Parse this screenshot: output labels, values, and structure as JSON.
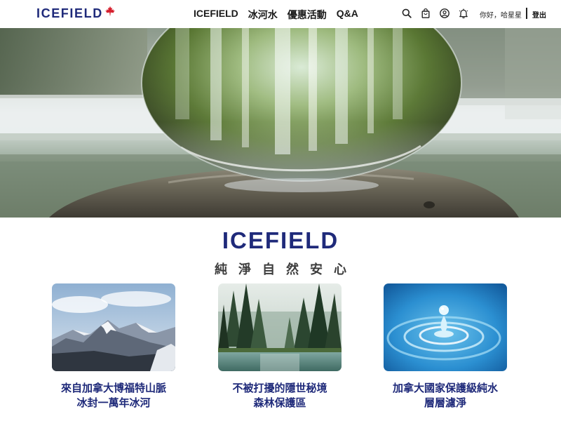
{
  "header": {
    "logo_text": "ICEFIELD",
    "logo_icon": "maple-leaf-icon",
    "nav": [
      {
        "label": "ICEFIELD"
      },
      {
        "label": "冰河水"
      },
      {
        "label": "優惠活動"
      },
      {
        "label": "Q&A"
      }
    ],
    "icons": [
      "search-icon",
      "shopping-bag-icon",
      "user-icon",
      "bell-icon"
    ],
    "greeting": "你好，哈星星",
    "logout_label": "登出"
  },
  "hero": {
    "image": "crystal-ball-waterfall-photo"
  },
  "brand": {
    "title": "ICEFIELD",
    "slogan": "純淨自然安心"
  },
  "features": [
    {
      "image": "snow-mountain-photo",
      "line1": "來自加拿大博福特山脈",
      "line2": "冰封一萬年冰河"
    },
    {
      "image": "forest-lake-photo",
      "line1": "不被打擾的隱世秘境",
      "line2": "森林保護區"
    },
    {
      "image": "water-droplet-photo",
      "line1": "加拿大國家保護級純水",
      "line2": "層層濾淨"
    }
  ],
  "colors": {
    "brand_navy": "#1f2a7a",
    "maple_red": "#d6202e",
    "slogan_gray": "#3d3d3d"
  }
}
